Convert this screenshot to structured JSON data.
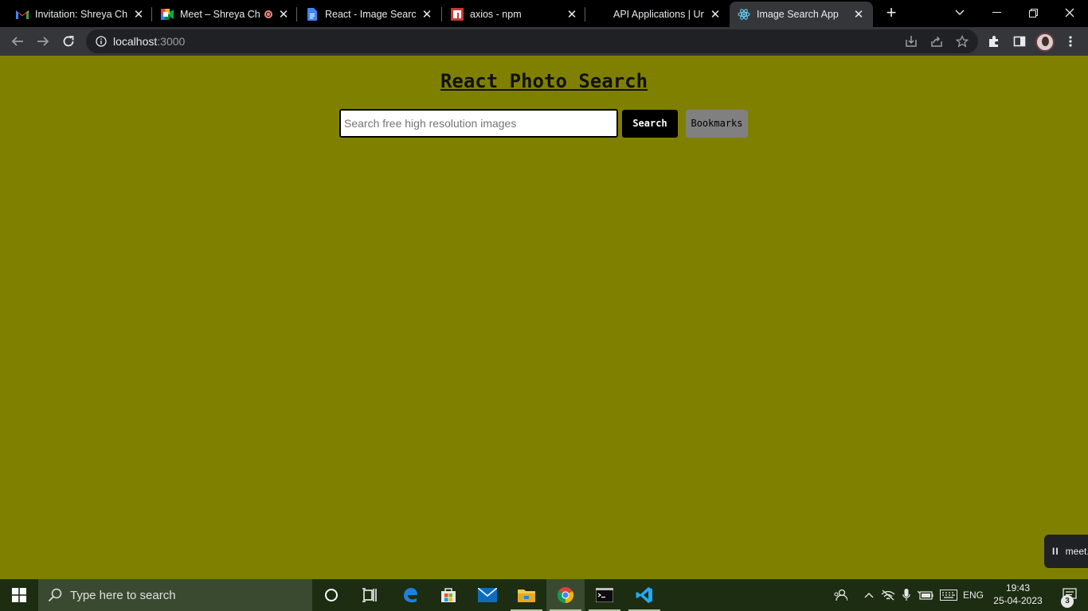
{
  "browser": {
    "tabs": [
      {
        "title": "Invitation: Shreya Cha",
        "icon": "gmail-icon"
      },
      {
        "title": "Meet – Shreya Ch",
        "icon": "meet-icon"
      },
      {
        "title": "React - Image Search",
        "icon": "docs-icon"
      },
      {
        "title": "axios - npm",
        "icon": "npm-icon"
      },
      {
        "title": "API Applications | Uns",
        "icon": "unsplash-icon"
      },
      {
        "title": "Image Search App",
        "icon": "react-icon"
      }
    ],
    "active_tab_index": 5,
    "address": {
      "host": "localhost",
      "port": ":3000"
    }
  },
  "page": {
    "heading": "React Photo Search",
    "search_placeholder": "Search free high resolution images",
    "search_value": "",
    "search_button": "Search",
    "bookmarks_button": "Bookmarks",
    "background_color": "#808000"
  },
  "meet_pill": {
    "pause": "II",
    "label": "meet."
  },
  "taskbar": {
    "search_placeholder": "Type here to search",
    "language": "ENG",
    "time": "19:43",
    "date": "25-04-2023",
    "notification_count": "3"
  }
}
